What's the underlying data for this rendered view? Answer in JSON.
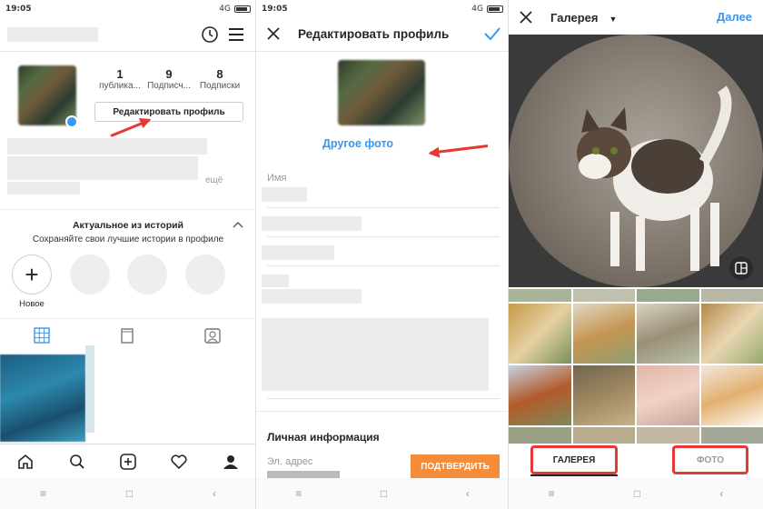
{
  "status": {
    "time": "19:05",
    "network": "4G"
  },
  "panel1": {
    "stats": [
      {
        "value": "1",
        "label": "публика..."
      },
      {
        "value": "9",
        "label": "Подписч..."
      },
      {
        "value": "8",
        "label": "Подписки"
      }
    ],
    "edit_button": "Редактировать профиль",
    "bio_more": "ещё",
    "highlights_title": "Актуальное из историй",
    "highlights_subtitle": "Сохраняйте свои лучшие истории в профиле",
    "new_label": "Новое",
    "icons": [
      "history-icon",
      "menu-icon",
      "grid-icon",
      "igtv-icon",
      "tagged-icon",
      "home-icon",
      "search-icon",
      "add-icon",
      "heart-icon",
      "profile-icon"
    ]
  },
  "panel2": {
    "title": "Редактировать профиль",
    "change_photo": "Другое фото",
    "name_label": "Имя",
    "personal_info": "Личная информация",
    "email_label": "Эл. адрес",
    "confirm_button": "ПОДТВЕРДИТЬ"
  },
  "panel3": {
    "title": "Галерея",
    "done": "Далее",
    "tab_gallery": "ГАЛЕРЕЯ",
    "tab_photo": "ФОТО"
  },
  "colors": {
    "accent": "#3897f0",
    "highlight": "#e53935",
    "confirm": "#f58c3a"
  }
}
